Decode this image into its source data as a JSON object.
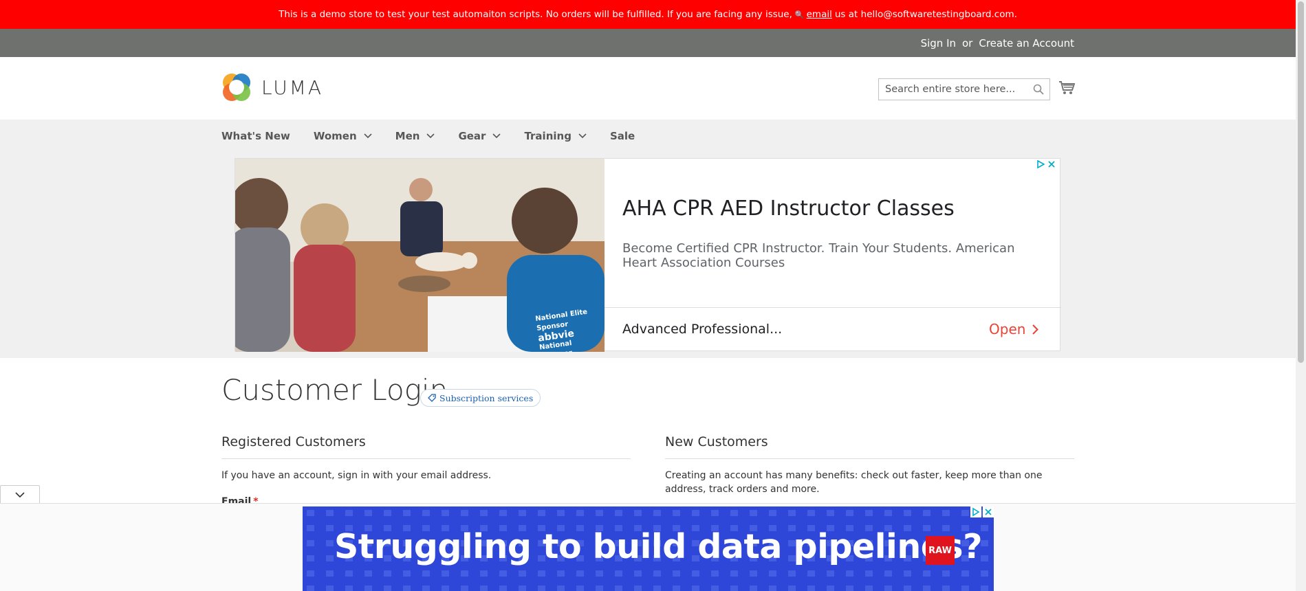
{
  "demo_notice": {
    "text": "This is a demo store to test your test automaiton scripts. No orders will be fulfilled. If you are facing any issue,",
    "key_icon": "key-icon",
    "email_link": "email",
    "suffix": "us at hello@softwaretestingboard.com."
  },
  "header_links": {
    "sign_in": "Sign In",
    "or": "or",
    "create_account": "Create an Account"
  },
  "logo": {
    "text": "LUMA"
  },
  "search": {
    "placeholder": "Search entire store here..."
  },
  "nav": {
    "items": [
      {
        "label": "What's New",
        "has_dropdown": false
      },
      {
        "label": "Women",
        "has_dropdown": true
      },
      {
        "label": "Men",
        "has_dropdown": true
      },
      {
        "label": "Gear",
        "has_dropdown": true
      },
      {
        "label": "Training",
        "has_dropdown": true
      },
      {
        "label": "Sale",
        "has_dropdown": false
      }
    ]
  },
  "ad_banner": {
    "title": "AHA CPR AED Instructor Classes",
    "description": "Become Certified CPR Instructor. Train Your Students. American Heart Association Courses",
    "sub_label": "Advanced Professional...",
    "cta": "Open",
    "photo_text_1": "National Elite Sponsor",
    "photo_text_2": "abbvie",
    "photo_text_3": "National Sponsor"
  },
  "page": {
    "title": "Customer Login",
    "badge": "Subscription services"
  },
  "registered": {
    "title": "Registered Customers",
    "text": "If you have an account, sign in with your email address.",
    "email_label": "Email",
    "required_mark": "*"
  },
  "new_customers": {
    "title": "New Customers",
    "text": "Creating an account has many benefits: check out faster, keep more than one address, track orders and more."
  },
  "anchor_ad": {
    "headline": "Struggling to build data pipelines?",
    "logo_text": "RAW"
  },
  "colors": {
    "demo_bar": "#ff0000",
    "panel_header": "#6e716e",
    "nav_bg": "#f0f0f0",
    "ad_cta": "#ea4335",
    "anchor_ad_bg": "#2e47d9"
  }
}
